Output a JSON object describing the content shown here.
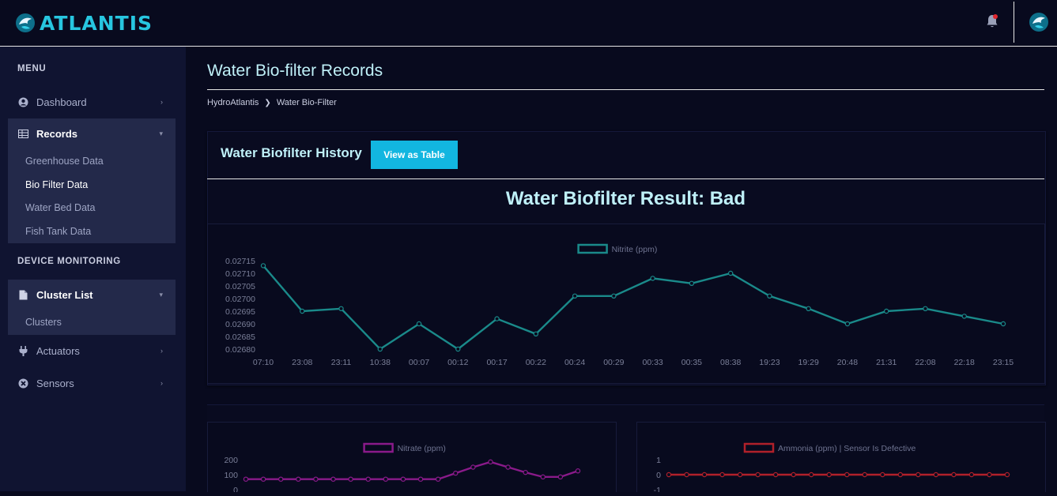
{
  "header": {
    "logo_text": "ATLANTIS",
    "bell_icon": "bell-icon",
    "avatar_icon": "dragon-emblem-icon",
    "notification_color": "#e0262e"
  },
  "sidebar": {
    "menu_heading": "MENU",
    "device_heading": "DEVICE MONITORING",
    "items": [
      {
        "label": "Dashboard",
        "icon": "user-circle-icon"
      },
      {
        "label": "Records",
        "icon": "table-icon"
      },
      {
        "label": "Cluster List",
        "icon": "file-icon"
      },
      {
        "label": "Actuators",
        "icon": "plug-icon"
      },
      {
        "label": "Sensors",
        "icon": "x-circle-icon"
      }
    ],
    "records_sub": [
      "Greenhouse Data",
      "Bio Filter Data",
      "Water Bed Data",
      "Fish Tank Data"
    ],
    "cluster_sub": [
      "Clusters"
    ]
  },
  "page": {
    "title": "Water Bio-filter Records",
    "breadcrumb": [
      "HydroAtlantis",
      "Water Bio-Filter"
    ],
    "card_title": "Water Biofilter History",
    "view_button": "View as Table",
    "result": "Water Biofilter Result: Bad",
    "accent_color": "#12b6e0"
  },
  "chart_data": [
    {
      "type": "line",
      "legend": "Nitrite (ppm)",
      "color": "#1a8a8a",
      "x": [
        "07:10",
        "23:08",
        "23:11",
        "10:38",
        "00:07",
        "00:12",
        "00:17",
        "00:22",
        "00:24",
        "00:29",
        "00:33",
        "00:35",
        "08:38",
        "19:23",
        "19:29",
        "20:48",
        "21:31",
        "22:08",
        "22:18",
        "23:15"
      ],
      "values": [
        0.02713,
        0.02695,
        0.02696,
        0.0268,
        0.0269,
        0.0268,
        0.02692,
        0.02686,
        0.02701,
        0.02701,
        0.02708,
        0.02706,
        0.0271,
        0.02701,
        0.02696,
        0.0269,
        0.02695,
        0.02696,
        0.02693,
        0.0269
      ],
      "yticks": [
        "0.02715",
        "0.02710",
        "0.02705",
        "0.02700",
        "0.02695",
        "0.02690",
        "0.02685",
        "0.02680"
      ],
      "ylim": [
        0.0268,
        0.02715
      ]
    },
    {
      "type": "line",
      "legend": "Nitrate (ppm)",
      "color": "#8a1a8a",
      "values": [
        70,
        70,
        70,
        70,
        70,
        70,
        70,
        70,
        70,
        70,
        70,
        70,
        110,
        150,
        185,
        150,
        115,
        85,
        85,
        125
      ],
      "yticks": [
        "200",
        "100",
        "0"
      ],
      "ylim": [
        0,
        200
      ]
    },
    {
      "type": "line",
      "legend": "Ammonia (ppm) | Sensor Is Defective",
      "color": "#b0202a",
      "values": [
        0,
        0,
        0,
        0,
        0,
        0,
        0,
        0,
        0,
        0,
        0,
        0,
        0,
        0,
        0,
        0,
        0,
        0,
        0,
        0
      ],
      "yticks": [
        "1",
        "0",
        "-1"
      ],
      "ylim": [
        -1,
        1
      ]
    }
  ]
}
